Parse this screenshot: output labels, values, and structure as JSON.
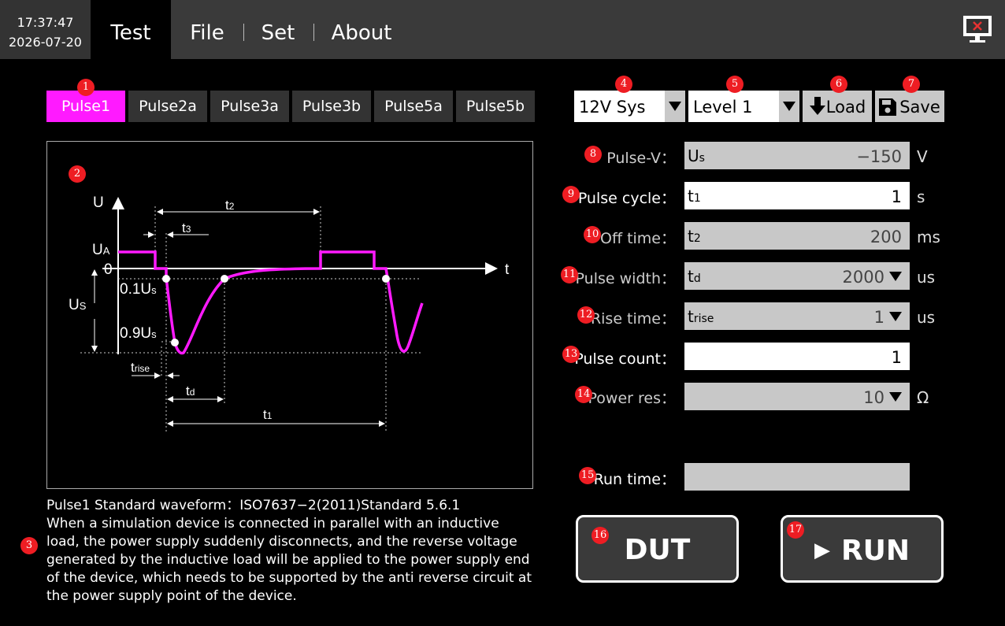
{
  "clock": {
    "time": "17:37:47",
    "date": "2026-07-20"
  },
  "menu": {
    "items": [
      "Test",
      "File",
      "Set",
      "About"
    ]
  },
  "tabs": [
    "Pulse1",
    "Pulse2a",
    "Pulse3a",
    "Pulse3b",
    "Pulse5a",
    "Pulse5b"
  ],
  "active_tab": "Pulse1",
  "badges": [
    "1",
    "2",
    "3",
    "4",
    "5",
    "6",
    "7",
    "8",
    "9",
    "10",
    "11",
    "12",
    "13",
    "14",
    "15",
    "16",
    "17"
  ],
  "diagram": {
    "axis_u": "U",
    "axis_t": "t",
    "ua": "U",
    "ua_sub": "A",
    "zero": "0",
    "us": "U",
    "us_sub": "S",
    "p01": "0.1U",
    "p01_sub": "s",
    "p09": "0.9U",
    "p09_sub": "s",
    "t1": "t",
    "t1_sub": "1",
    "t2": "t",
    "t2_sub": "2",
    "t3": "t",
    "t3_sub": "3",
    "td": "t",
    "td_sub": "d",
    "trise": "t",
    "trise_sub": "rise"
  },
  "description": {
    "title": "Pulse1 Standard waveform：ISO7637−2(2011)Standard 5.6.1",
    "lines": [
      "When a simulation device is connected in parallel with an inductive",
      "load, the power supply suddenly disconnects, and the reverse voltage",
      "generated by the inductive load will be applied to the power supply end",
      "of the device, which needs to be supported by the anti reverse circuit at",
      "the power supply point of the device."
    ]
  },
  "selects": {
    "system": "12V Sys",
    "level": "Level 1"
  },
  "buttons": {
    "load": "Load",
    "save": "Save",
    "dut": "DUT",
    "run": "RUN"
  },
  "icons": {
    "load": "download-arrow-icon",
    "save": "floppy-disk-icon",
    "run": "play-icon",
    "exit": "monitor-close-icon"
  },
  "fields": {
    "pulse_v": {
      "label": "Pulse-V：",
      "prefix": "U",
      "prefix_sub": "s",
      "value": "−150",
      "unit": "V"
    },
    "pulse_cycle": {
      "label": "Pulse cycle：",
      "prefix": "t",
      "prefix_sub": "1",
      "value": "1",
      "unit": "s"
    },
    "off_time": {
      "label": "Off time：",
      "prefix": "t",
      "prefix_sub": "2",
      "value": "200",
      "unit": "ms"
    },
    "pulse_width": {
      "label": "Pulse width：",
      "prefix": "t",
      "prefix_sub": "d",
      "value": "2000",
      "unit": "us"
    },
    "rise_time": {
      "label": "Rise time：",
      "prefix": "t",
      "prefix_sub": "rise",
      "value": "1",
      "unit": "us"
    },
    "pulse_count": {
      "label": "Pulse count：",
      "value": "1"
    },
    "power_res": {
      "label": "Power res：",
      "value": "10",
      "unit": "Ω"
    },
    "run_time": {
      "label": "Run time：",
      "value": ""
    }
  },
  "colors": {
    "accent": "#ff1aff",
    "badge": "#ee1d23",
    "topbar": "#3a3a3a",
    "field_gray": "#c8c8c8"
  }
}
